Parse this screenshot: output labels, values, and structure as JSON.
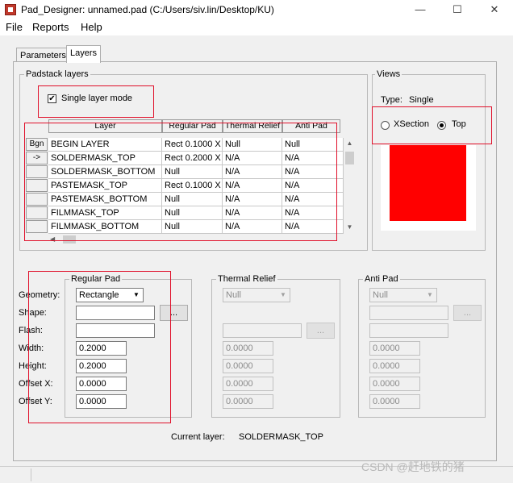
{
  "window": {
    "title": "Pad_Designer: unnamed.pad (C:/Users/siv.lin/Desktop/KU)",
    "minimize": "—",
    "maximize": "☐",
    "close": "✕"
  },
  "menu": [
    "File",
    "Reports",
    "Help"
  ],
  "tabs": [
    "Parameters",
    "Layers"
  ],
  "active_tab": "Layers",
  "padstack": {
    "group_label": "Padstack layers",
    "single_layer_label": "Single layer mode",
    "single_layer_checked": true,
    "columns": [
      "Layer",
      "Regular Pad",
      "Thermal Relief",
      "Anti Pad"
    ],
    "row_headers": [
      "Bgn",
      "->",
      "",
      "",
      "",
      "",
      ""
    ],
    "rows": [
      [
        "BEGIN LAYER",
        "Rect 0.1000 X",
        "Null",
        "Null"
      ],
      [
        "SOLDERMASK_TOP",
        "Rect 0.2000 X",
        "N/A",
        "N/A"
      ],
      [
        "SOLDERMASK_BOTTOM",
        "Null",
        "N/A",
        "N/A"
      ],
      [
        "PASTEMASK_TOP",
        "Rect 0.1000 X",
        "N/A",
        "N/A"
      ],
      [
        "PASTEMASK_BOTTOM",
        "Null",
        "N/A",
        "N/A"
      ],
      [
        "FILMMASK_TOP",
        "Null",
        "N/A",
        "N/A"
      ],
      [
        "FILMMASK_BOTTOM",
        "Null",
        "N/A",
        "N/A"
      ]
    ]
  },
  "views": {
    "group_label": "Views",
    "type_label": "Type:",
    "type_value": "Single",
    "options": [
      "XSection",
      "Top"
    ],
    "selected": "Top",
    "preview_color": "#ff0000"
  },
  "field_labels": {
    "geometry": "Geometry:",
    "shape": "Shape:",
    "flash": "Flash:",
    "width": "Width:",
    "height": "Height:",
    "offset_x": "Offset X:",
    "offset_y": "Offset Y:"
  },
  "regular_pad": {
    "group_label": "Regular Pad",
    "geometry": "Rectangle",
    "shape": "",
    "flash": "",
    "width": "0.2000",
    "height": "0.2000",
    "offset_x": "0.0000",
    "offset_y": "0.0000",
    "browse_label": "..."
  },
  "thermal_relief": {
    "group_label": "Thermal Relief",
    "geometry": "Null",
    "flash": "",
    "width": "0.0000",
    "height": "0.0000",
    "offset_x": "0.0000",
    "offset_y": "0.0000",
    "browse_label": "..."
  },
  "anti_pad": {
    "group_label": "Anti Pad",
    "geometry": "Null",
    "shape": "",
    "width": "0.0000",
    "height": "0.0000",
    "offset_x": "0.0000",
    "offset_y": "0.0000",
    "browse_label": "..."
  },
  "current_layer": {
    "label": "Current layer:",
    "value": "SOLDERMASK_TOP"
  },
  "watermark": "CSDN @赶地铁的猪",
  "colors": {
    "highlight": "#e0102a",
    "preview": "#ff0000"
  }
}
